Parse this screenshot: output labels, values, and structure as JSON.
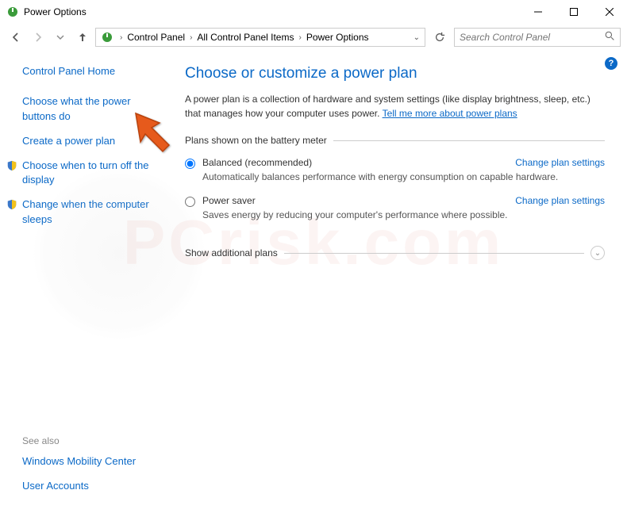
{
  "window": {
    "title": "Power Options"
  },
  "breadcrumb": {
    "items": [
      "Control Panel",
      "All Control Panel Items",
      "Power Options"
    ]
  },
  "search": {
    "placeholder": "Search Control Panel"
  },
  "sidebar": {
    "home": "Control Panel Home",
    "links": [
      "Choose what the power buttons do",
      "Create a power plan",
      "Choose when to turn off the display",
      "Change when the computer sleeps"
    ],
    "see_also_label": "See also",
    "see_also": [
      "Windows Mobility Center",
      "User Accounts"
    ]
  },
  "main": {
    "heading": "Choose or customize a power plan",
    "desc_prefix": "A power plan is a collection of hardware and system settings (like display brightness, sleep, etc.) that manages how your computer uses power. ",
    "desc_link": "Tell me more about power plans",
    "plans_legend": "Plans shown on the battery meter",
    "plans": [
      {
        "name": "Balanced (recommended)",
        "desc": "Automatically balances performance with energy consumption on capable hardware.",
        "change": "Change plan settings",
        "selected": true
      },
      {
        "name": "Power saver",
        "desc": "Saves energy by reducing your computer's performance where possible.",
        "change": "Change plan settings",
        "selected": false
      }
    ],
    "show_more": "Show additional plans"
  },
  "watermark": "PCrisk.com"
}
